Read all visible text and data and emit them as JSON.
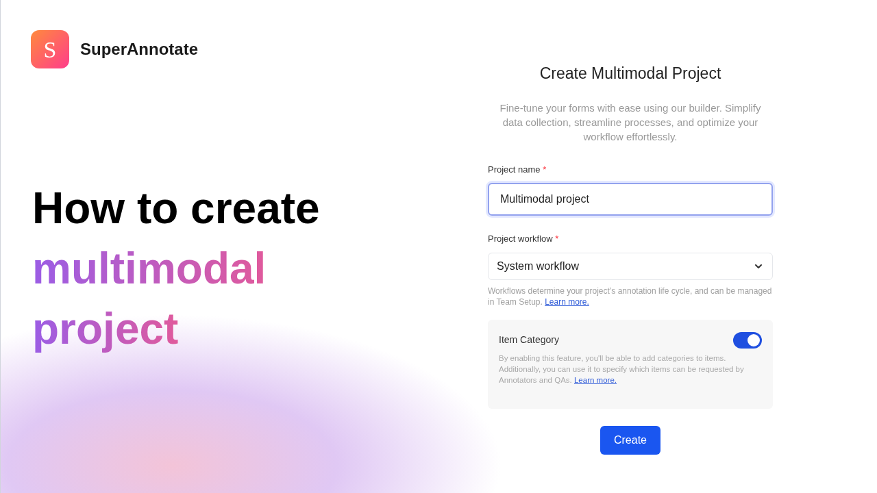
{
  "brand": {
    "logo_letter": "S",
    "name": "SuperAnnotate"
  },
  "headline": [
    {
      "text": "How to create",
      "kind": "plain"
    },
    {
      "text": "multimodal",
      "kind": "gradient"
    },
    {
      "text": "project",
      "kind": "gradient"
    }
  ],
  "form": {
    "title": "Create Multimodal Project",
    "description": "Fine-tune your forms with ease using our builder. Simplify data collection, streamline processes, and optimize your workflow effortlessly.",
    "fields": [
      {
        "kind": "text",
        "label": "Project name",
        "required_mark": "*",
        "value": "Multimodal project",
        "focused": true
      },
      {
        "kind": "select",
        "label": "Project workflow",
        "required_mark": "*",
        "value": "System workflow",
        "focused": false,
        "help": "Workflows determine your project’s annotation life cycle, and can be managed in Team Setup.",
        "help_link": "Learn more."
      }
    ],
    "setting": {
      "title": "Item Category",
      "on": true,
      "description": "By enabling this feature, you'll be able to add categories to items. Additionally, you can use it to specify which items can be requested by Annotators and QAs.",
      "link": "Learn more."
    },
    "submit": "Create"
  }
}
